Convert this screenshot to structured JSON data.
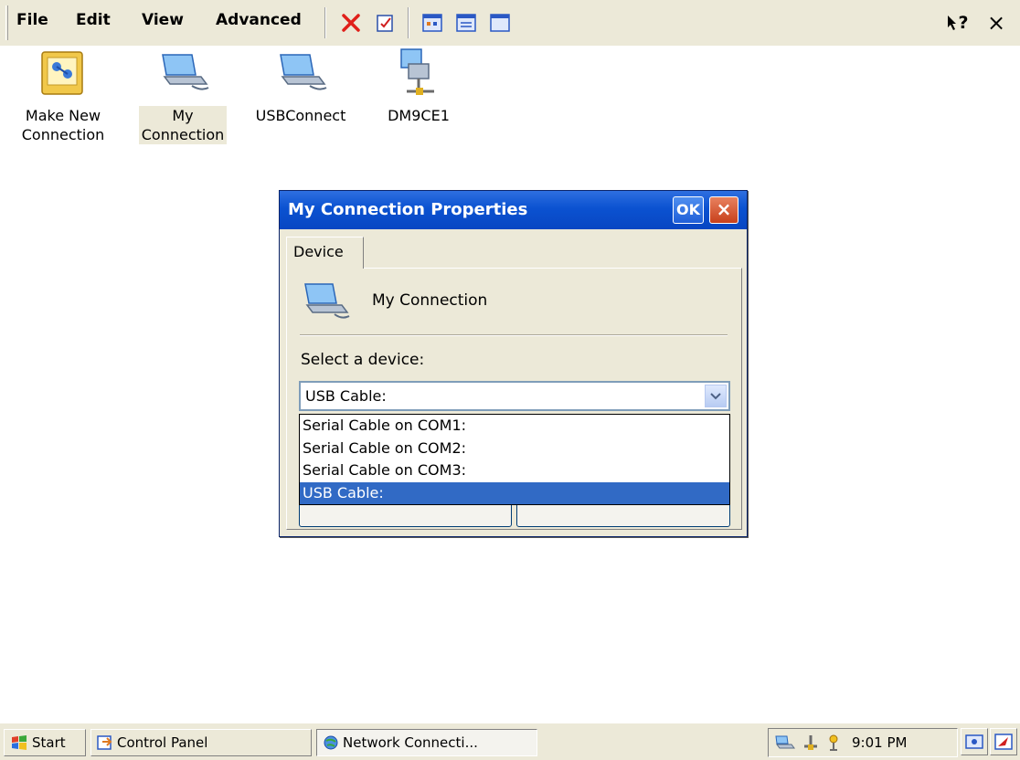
{
  "menubar": {
    "file": "File",
    "edit": "Edit",
    "view": "View",
    "advanced": "Advanced",
    "help_glyph": "?",
    "close_glyph": "×"
  },
  "desktop_icons": [
    {
      "label": "Make New\nConnection",
      "icon": "make-new-connection-icon"
    },
    {
      "label": "My\nConnection",
      "icon": "network-connection-icon",
      "selected": true
    },
    {
      "label": "USBConnect",
      "icon": "network-connection-icon"
    },
    {
      "label": "DM9CE1",
      "icon": "lan-adapter-icon"
    }
  ],
  "dialog": {
    "title": "My Connection Properties",
    "ok_label": "OK",
    "close_label": "×",
    "tab_label": "Device",
    "connection_name": "My Connection",
    "select_label": "Select a device:",
    "selected_device": "USB Cable:",
    "device_options": [
      "Serial Cable on COM1:",
      "Serial Cable on COM2:",
      "Serial Cable on COM3:",
      "USB Cable:"
    ],
    "highlighted_option_index": 3
  },
  "taskbar": {
    "start_label": "Start",
    "control_panel_label": "Control Panel",
    "network_label": "Network Connecti...",
    "clock": "9:01 PM"
  },
  "colors": {
    "title_blue": "#0b52d1",
    "selection_blue": "#316ac5",
    "face": "#ece9d8"
  }
}
